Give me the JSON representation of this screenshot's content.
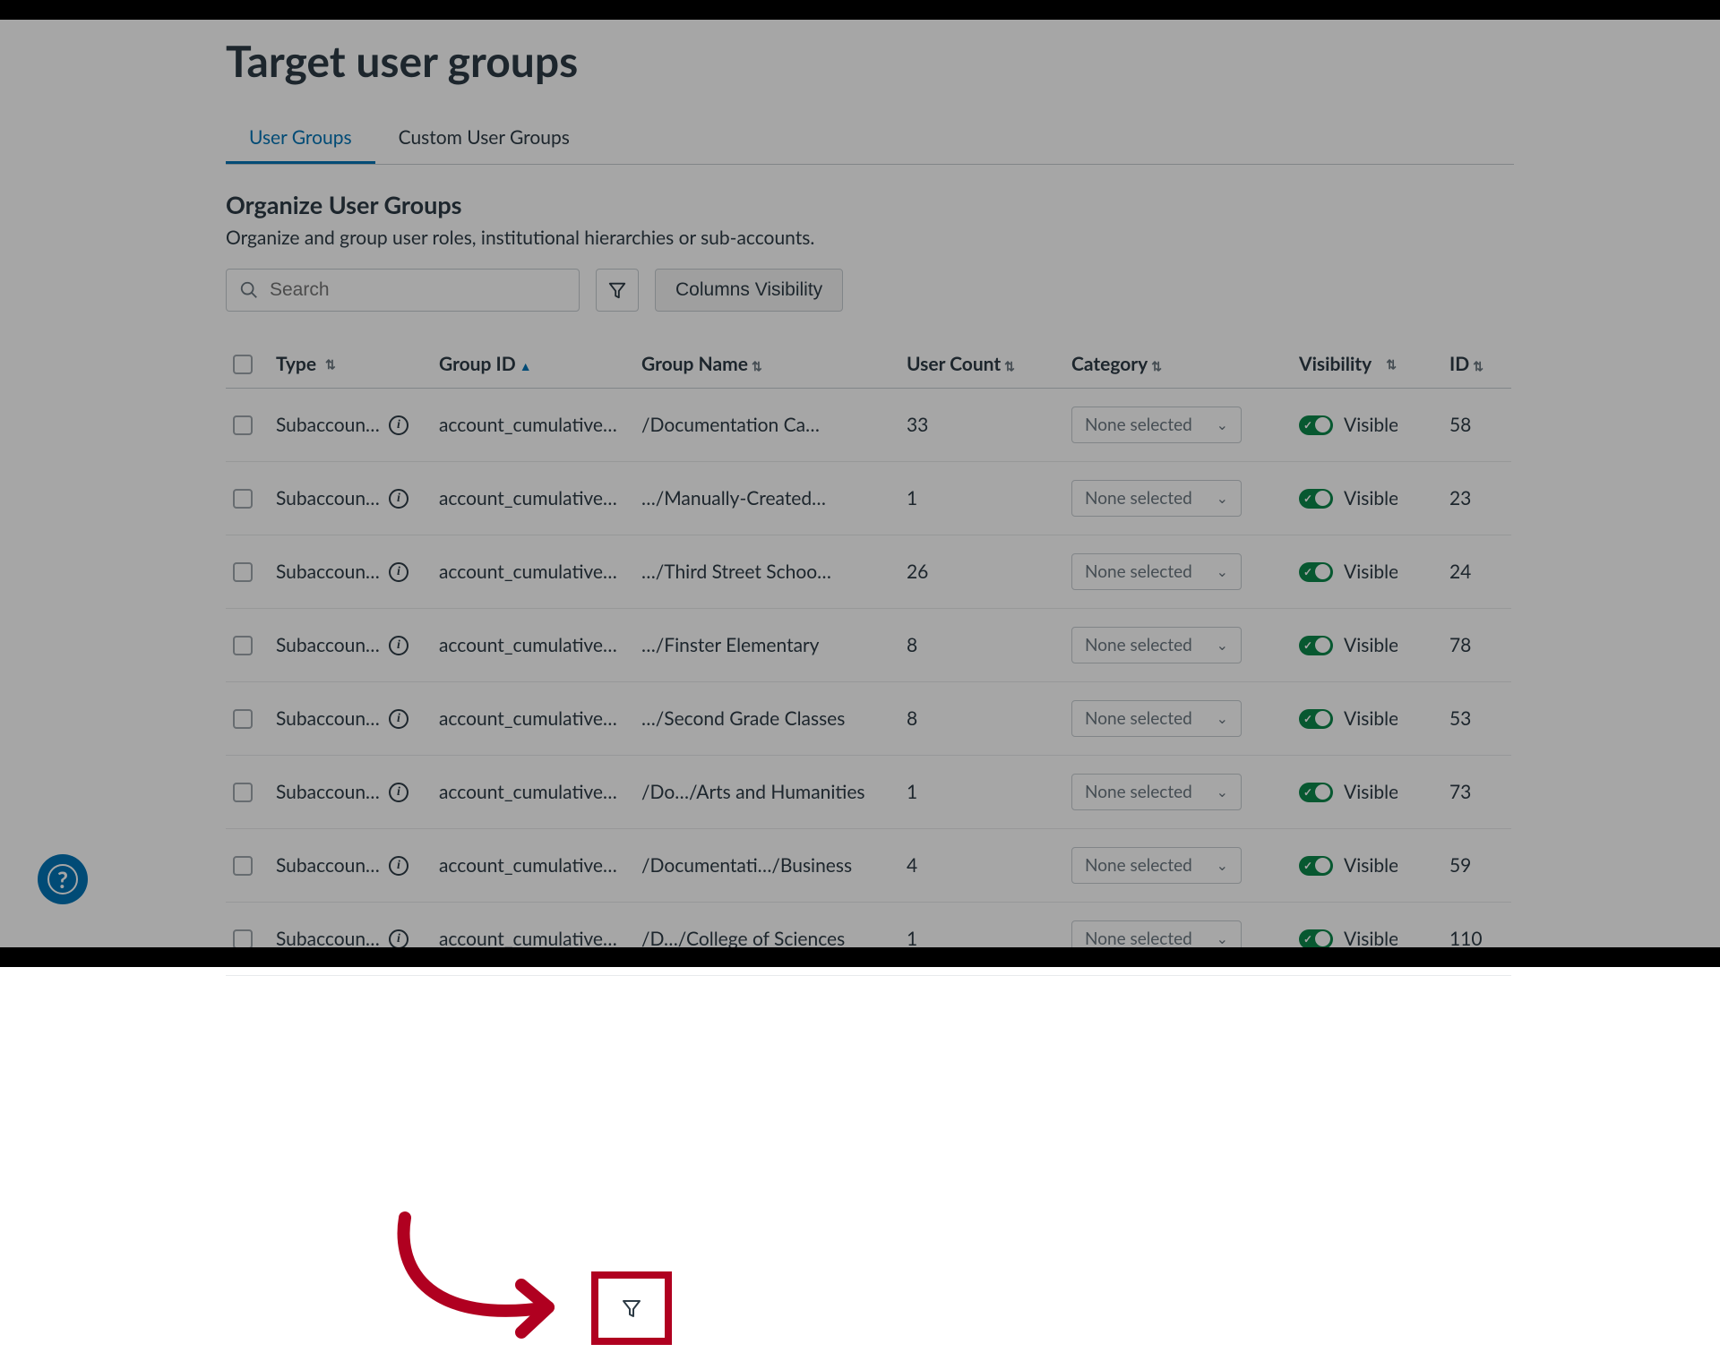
{
  "page": {
    "title": "Target user groups"
  },
  "tabs": {
    "items": [
      {
        "label": "User Groups",
        "active": true
      },
      {
        "label": "Custom User Groups",
        "active": false
      }
    ]
  },
  "section": {
    "title": "Organize User Groups",
    "description": "Organize and group user roles, institutional hierarchies or sub-accounts."
  },
  "toolbar": {
    "search_placeholder": "Search",
    "columns_button": "Columns Visibility"
  },
  "table": {
    "headers": {
      "type": "Type",
      "group_id": "Group ID",
      "group_name": "Group Name",
      "user_count": "User Count",
      "category": "Category",
      "visibility": "Visibility",
      "id": "ID"
    },
    "sorted_column": "group_id",
    "rows": [
      {
        "type": "Subaccount…",
        "group_id": "account_cumulative…",
        "group_name": "/Documentation Ca…",
        "user_count": "33",
        "category": "None selected",
        "visibility": "Visible",
        "id": "58"
      },
      {
        "type": "Subaccount…",
        "group_id": "account_cumulative…",
        "group_name": "…/Manually-Created…",
        "user_count": "1",
        "category": "None selected",
        "visibility": "Visible",
        "id": "23"
      },
      {
        "type": "Subaccount…",
        "group_id": "account_cumulative…",
        "group_name": "…/Third Street Schoo…",
        "user_count": "26",
        "category": "None selected",
        "visibility": "Visible",
        "id": "24"
      },
      {
        "type": "Subaccount…",
        "group_id": "account_cumulative…",
        "group_name": "…/Finster Elementary",
        "user_count": "8",
        "category": "None selected",
        "visibility": "Visible",
        "id": "78"
      },
      {
        "type": "Subaccount…",
        "group_id": "account_cumulative…",
        "group_name": "…/Second Grade Classes",
        "user_count": "8",
        "category": "None selected",
        "visibility": "Visible",
        "id": "53"
      },
      {
        "type": "Subaccount…",
        "group_id": "account_cumulative…",
        "group_name": "/Do…/Arts and Humanities",
        "user_count": "1",
        "category": "None selected",
        "visibility": "Visible",
        "id": "73"
      },
      {
        "type": "Subaccount…",
        "group_id": "account_cumulative…",
        "group_name": "/Documentati…/Business",
        "user_count": "4",
        "category": "None selected",
        "visibility": "Visible",
        "id": "59"
      },
      {
        "type": "Subaccount…",
        "group_id": "account_cumulative…",
        "group_name": "/D…/College of Sciences",
        "user_count": "1",
        "category": "None selected",
        "visibility": "Visible",
        "id": "110"
      }
    ]
  },
  "annotation": {
    "highlight_color": "#b00020",
    "target": "filter-button"
  }
}
